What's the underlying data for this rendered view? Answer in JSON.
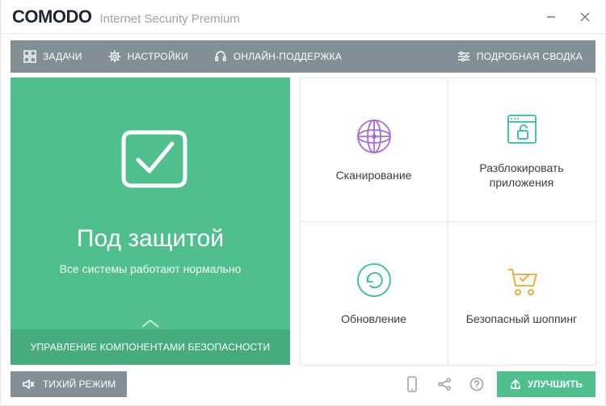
{
  "colors": {
    "accent_green": "#4fc08d",
    "toolbar_gray": "#838f97",
    "tile_purple": "#a86bd6",
    "tile_teal": "#2bbfa0",
    "tile_orange": "#f5a623"
  },
  "titlebar": {
    "logo": "COMODO",
    "product": "Internet Security Premium"
  },
  "toolbar": {
    "tasks": "ЗАДАЧИ",
    "settings": "НАСТРОЙКИ",
    "support": "ОНЛАЙН-ПОДДЕРЖКА",
    "detailed": "ПОДРОБНАЯ СВОДКА"
  },
  "status": {
    "title": "Под защитой",
    "subtitle": "Все системы работают нормально",
    "footer": "УПРАВЛЕНИЕ КОМПОНЕНТАМИ БЕЗОПАСНОСТИ"
  },
  "tiles": {
    "scan": "Сканирование",
    "unblock": "Разблокировать приложения",
    "update": "Обновление",
    "shopping": "Безопасный шоппинг"
  },
  "footer": {
    "silent": "ТИХИЙ РЕЖИМ",
    "upgrade": "УЛУЧШИТЬ"
  }
}
